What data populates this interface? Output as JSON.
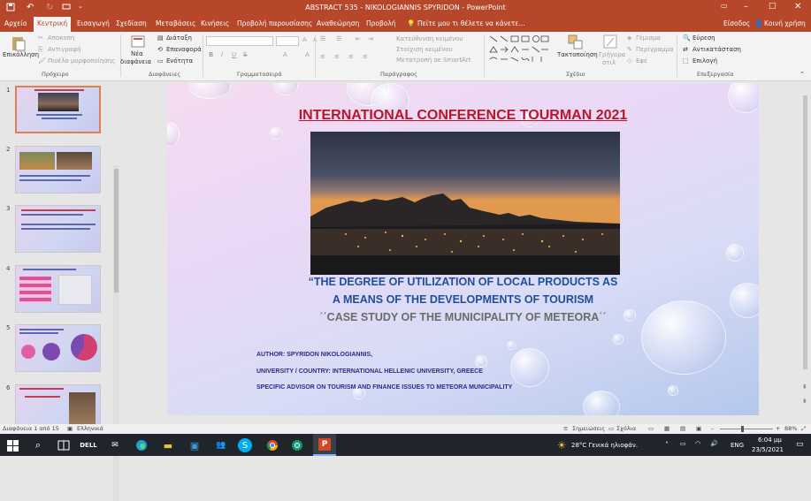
{
  "window": {
    "title": "ABSTRACT 535 - NIKOLOGIANNIS SPYRIDON - PowerPoint"
  },
  "tabs": [
    "Αρχείο",
    "Κεντρική",
    "Εισαγωγή",
    "Σχεδίαση",
    "Μεταβάσεις",
    "Κινήσεις",
    "Προβολή παρουσίασης",
    "Αναθεώρηση",
    "Προβολή"
  ],
  "tell_me": "Πείτε μου τι θέλετε να κάνετε...",
  "signin": "Είσοδος",
  "share": "Κοινή χρήση",
  "ribbon": {
    "clipboard": {
      "paste": "Επικόλληση",
      "cut": "Αποκοπή",
      "copy": "Αντιγραφή",
      "painter": "Πινέλο μορφοποίησης",
      "group": "Πρόχειρο"
    },
    "slides": {
      "new": "Νέα",
      "new2": "διαφάνεια",
      "layout": "Διάταξη",
      "reset": "Επαναφορά",
      "section": "Ενότητα",
      "group": "Διαφάνειες"
    },
    "font": {
      "group": "Γραμματοσειρά",
      "bold": "B",
      "italic": "I",
      "underline": "U",
      "strike": "S",
      "grow": "A",
      "shrink": "A"
    },
    "paragraph": {
      "group": "Παράγραφος",
      "direction": "Κατεύθυνση κειμένου",
      "align": "Στοίχιση κειμένου",
      "smartart": "Μετατροπή σε SmartArt"
    },
    "drawing": {
      "group": "Σχέδιο",
      "arrange": "Τακτοποίηση",
      "quick": "Γρήγορα",
      "quick2": "στιλ",
      "fill": "Γέμισμα",
      "outline": "Περίγραμμα",
      "effects": "Εφέ"
    },
    "editing": {
      "group": "Επεξεργασία",
      "find": "Εύρεση",
      "replace": "Αντικατάσταση",
      "select": "Επιλογή"
    }
  },
  "thumbnails": [
    "1",
    "2",
    "3",
    "4",
    "5",
    "6"
  ],
  "slide": {
    "title": "INTERNATIONAL CONFERENCE TOURMAN 2021",
    "sub1": "“THE DEGREE OF UTILIZATION OF LOCAL PRODUCTS AS",
    "sub2": "A MEANS OF THE DEVELOPMENTS OF TOURISM",
    "sub3": "΄΄CASE STUDY OF THE MUNICIPALITY OF METEORA΄΄",
    "author": "AUTHOR: SPYRIDON NIKOLOGIANNIS,",
    "university": "UNIVERSITY / COUNTRY: INTERNATIONAL HELLENIC UNIVERSITY, GREECE",
    "advisor": "SPECIFIC ADVISOR ON TOURISM AND FINANCE ISSUES TO METEORA MUNICIPALITY"
  },
  "status": {
    "slide": "Διαφάνεια 1 από 15",
    "language": "Ελληνικά",
    "notes": "Σημειώσεις",
    "comments": "Σχόλια",
    "zoom": "88%"
  },
  "taskbar": {
    "weather": "28°C  Γενικά ηλιοφάν.",
    "lang": "ENG",
    "time": "6:04 μμ",
    "date": "23/5/2021"
  },
  "colors": {
    "accent": "#b7472a",
    "title_red": "#b7162c",
    "sub_blue": "#1f4f9a",
    "author_navy": "#2a2a8c"
  }
}
